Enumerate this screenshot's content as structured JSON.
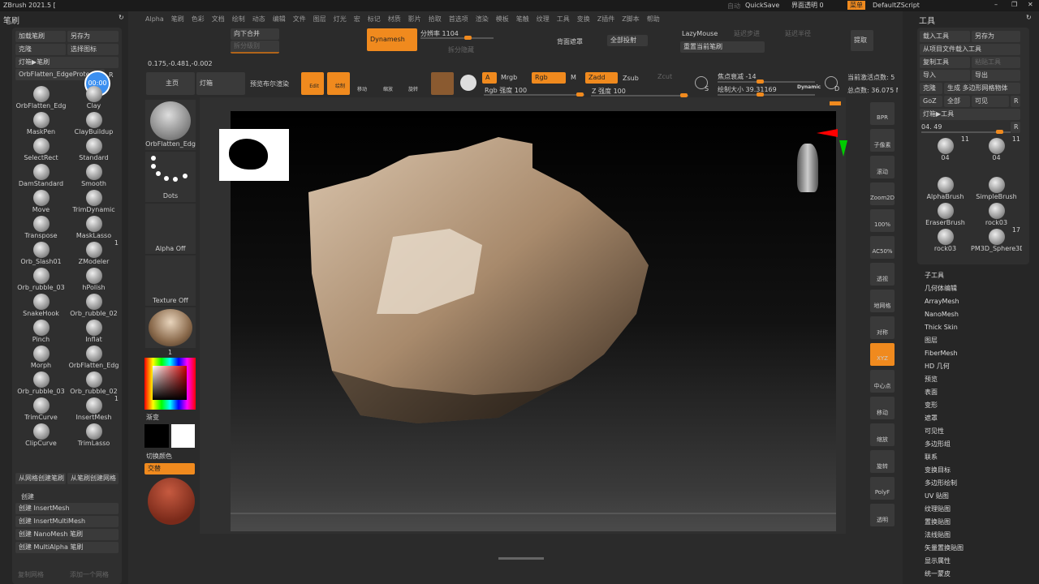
{
  "title": "ZBrush 2021.5 [",
  "titlebar": {
    "auto": "自动",
    "quicksave": "QuickSave",
    "transparency": "界面透明 0",
    "menu": "菜单",
    "script": "DefaultZScript"
  },
  "menu": [
    "Alpha",
    "笔刷",
    "色彩",
    "文档",
    "绘制",
    "动态",
    "编辑",
    "文件",
    "图层",
    "灯光",
    "宏",
    "标记",
    "材质",
    "影片",
    "拾取",
    "首选项",
    "渲染",
    "模板",
    "笔触",
    "纹理",
    "工具",
    "变换",
    "Z插件",
    "Z脚本",
    "帮助"
  ],
  "coords": "0.175,-0.481,-0.002",
  "toolbar": {
    "merge_down": "向下合并",
    "split_level": "拆分级别",
    "dynamesh": "Dynamesh",
    "resolution": "分辨率 1104",
    "split_hidden": "拆分隐藏",
    "backface": "背面遮罩",
    "project_all": "全部投射",
    "lazymouse": "LazyMouse",
    "lazy_step": "延迟步进",
    "lazy_radius": "延迟半径",
    "reset_brush": "重置当前笔刷",
    "extract": "提取",
    "home": "主页",
    "lightbox": "灯箱",
    "boolean_preview": "预览布尔渲染",
    "edit": "Edit",
    "draw": "绘制",
    "move": "移动",
    "scale": "缩放",
    "rotate": "旋转",
    "a": "A",
    "mrgb": "Mrgb",
    "rgb": "Rgb",
    "m": "M",
    "zadd": "Zadd",
    "zsub": "Zsub",
    "zcut": "Zcut",
    "rgb_intensity": "Rgb 强度 100",
    "z_intensity": "Z 强度 100",
    "focal": "焦点衰减 -14",
    "draw_size": "绘制大小 39.31169",
    "dynamic": "Dynamic",
    "s": "S",
    "d": "D",
    "active_points": "当前激活点数: 5",
    "total_points": "总点数: 36.075 M"
  },
  "left": {
    "header": "笔刷",
    "load": "加载笔刷",
    "saveas": "另存为",
    "clone": "克隆",
    "select_icon": "选择图标",
    "lightbox_brush": "灯箱▶笔刷",
    "current": "OrbFlatten_EdgeProte",
    "r": "R",
    "timer": "00:00",
    "brushes": [
      {
        "n": "OrbFlatten_Edg"
      },
      {
        "n": "Clay"
      },
      {
        "n": "MaskPen"
      },
      {
        "n": "ClayBuildup"
      },
      {
        "n": "SelectRect"
      },
      {
        "n": "Standard"
      },
      {
        "n": "DamStandard"
      },
      {
        "n": "Smooth"
      },
      {
        "n": "Move"
      },
      {
        "n": "TrimDynamic"
      },
      {
        "n": "Transpose"
      },
      {
        "n": "MaskLasso"
      },
      {
        "n": "Orb_Slash01"
      },
      {
        "n": "ZModeler",
        "c": "1"
      },
      {
        "n": "Orb_rubble_03"
      },
      {
        "n": "hPolish"
      },
      {
        "n": "SnakeHook"
      },
      {
        "n": "Orb_rubble_02"
      },
      {
        "n": "Pinch"
      },
      {
        "n": "Inflat"
      },
      {
        "n": "Morph"
      },
      {
        "n": "OrbFlatten_Edg"
      },
      {
        "n": "Orb_rubble_03"
      },
      {
        "n": "Orb_rubble_02"
      },
      {
        "n": "TrimCurve"
      },
      {
        "n": "InsertMesh",
        "c": "1"
      },
      {
        "n": "ClipCurve"
      },
      {
        "n": "TrimLasso"
      }
    ],
    "from_mesh": "从网格创建笔刷",
    "from_brush": "从笔刷创建网格",
    "create": "创建",
    "create_items": [
      "创建 InsertMesh",
      "创建 InsertMultiMesh",
      "创建 NanoMesh 笔刷",
      "创建 MultiAlpha 笔刷"
    ],
    "bottom1": "复制网格",
    "bottom2": "添加一个网格"
  },
  "shelf": {
    "brush": "OrbFlatten_Edg",
    "stroke": "Dots",
    "alpha": "Alpha Off",
    "texture": "Texture Off",
    "material": "1",
    "gradient": "渐变",
    "switch_color": "切换颜色",
    "alternate": "交替"
  },
  "rshelf": [
    "BPR",
    "子像素",
    "滚动",
    "Zoom2D",
    "100%",
    "AC50%",
    "透视",
    "地网格",
    "对称",
    "XYZ",
    "中心点",
    "移动",
    "缩放",
    "旋转",
    "PolyF",
    "透明"
  ],
  "right": {
    "header": "工具",
    "load": "载入工具",
    "saveas": "另存为",
    "load_project": "从项目文件载入工具",
    "copy": "复制工具",
    "paste": "粘贴工具",
    "import": "导入",
    "export": "导出",
    "clone": "克隆",
    "make_poly": "生成 多边形网格物体",
    "goz": "GoZ",
    "all": "全部",
    "visible": "可见",
    "r": "R",
    "lightbox_tool": "灯箱▶工具",
    "current": "04. 49",
    "tools": [
      {
        "n": "04",
        "c": "11"
      },
      {
        "n": "04",
        "c": "11"
      },
      {
        "n": "AlphaBrush"
      },
      {
        "n": "SimpleBrush"
      },
      {
        "n": "EraserBrush"
      },
      {
        "n": "rock03"
      },
      {
        "n": "rock03"
      },
      {
        "n": "PM3D_Sphere3D",
        "c": "17"
      }
    ],
    "menu": [
      "子工具",
      "几何体编辑",
      "ArrayMesh",
      "NanoMesh",
      "Thick Skin",
      "图层",
      "FiberMesh",
      "HD 几何",
      "预览",
      "表面",
      "变形",
      "遮罩",
      "可见性",
      "多边形组",
      "联系",
      "变换目标",
      "多边形绘制",
      "UV 贴图",
      "纹理贴图",
      "置换贴图",
      "法线贴图",
      "矢量置换贴图",
      "显示属性",
      "统一蒙皮"
    ]
  },
  "colors": {
    "accent": "#f08a1e",
    "panel": "#2b2b2b",
    "button": "#3a3a3a"
  }
}
